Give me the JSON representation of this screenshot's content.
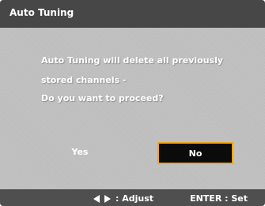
{
  "dialog": {
    "title": "Auto Tuning",
    "message": {
      "line1": "Auto Tuning will delete all previously",
      "line2": "stored channels -",
      "line3": "Do you want to proceed?"
    },
    "buttons": {
      "yes": "Yes",
      "no": "No"
    }
  },
  "footer": {
    "adjust_label": ": Adjust",
    "enter_label": "ENTER : Set",
    "adjust_icon": "left-right-arrows-icon"
  },
  "colors": {
    "title_bar": "#474747",
    "panel": "#bdbdbd",
    "focus_border": "#f2a51a",
    "focus_fill": "#0b0b0b",
    "footer": "#4f4f4f",
    "text": "#ffffff"
  }
}
